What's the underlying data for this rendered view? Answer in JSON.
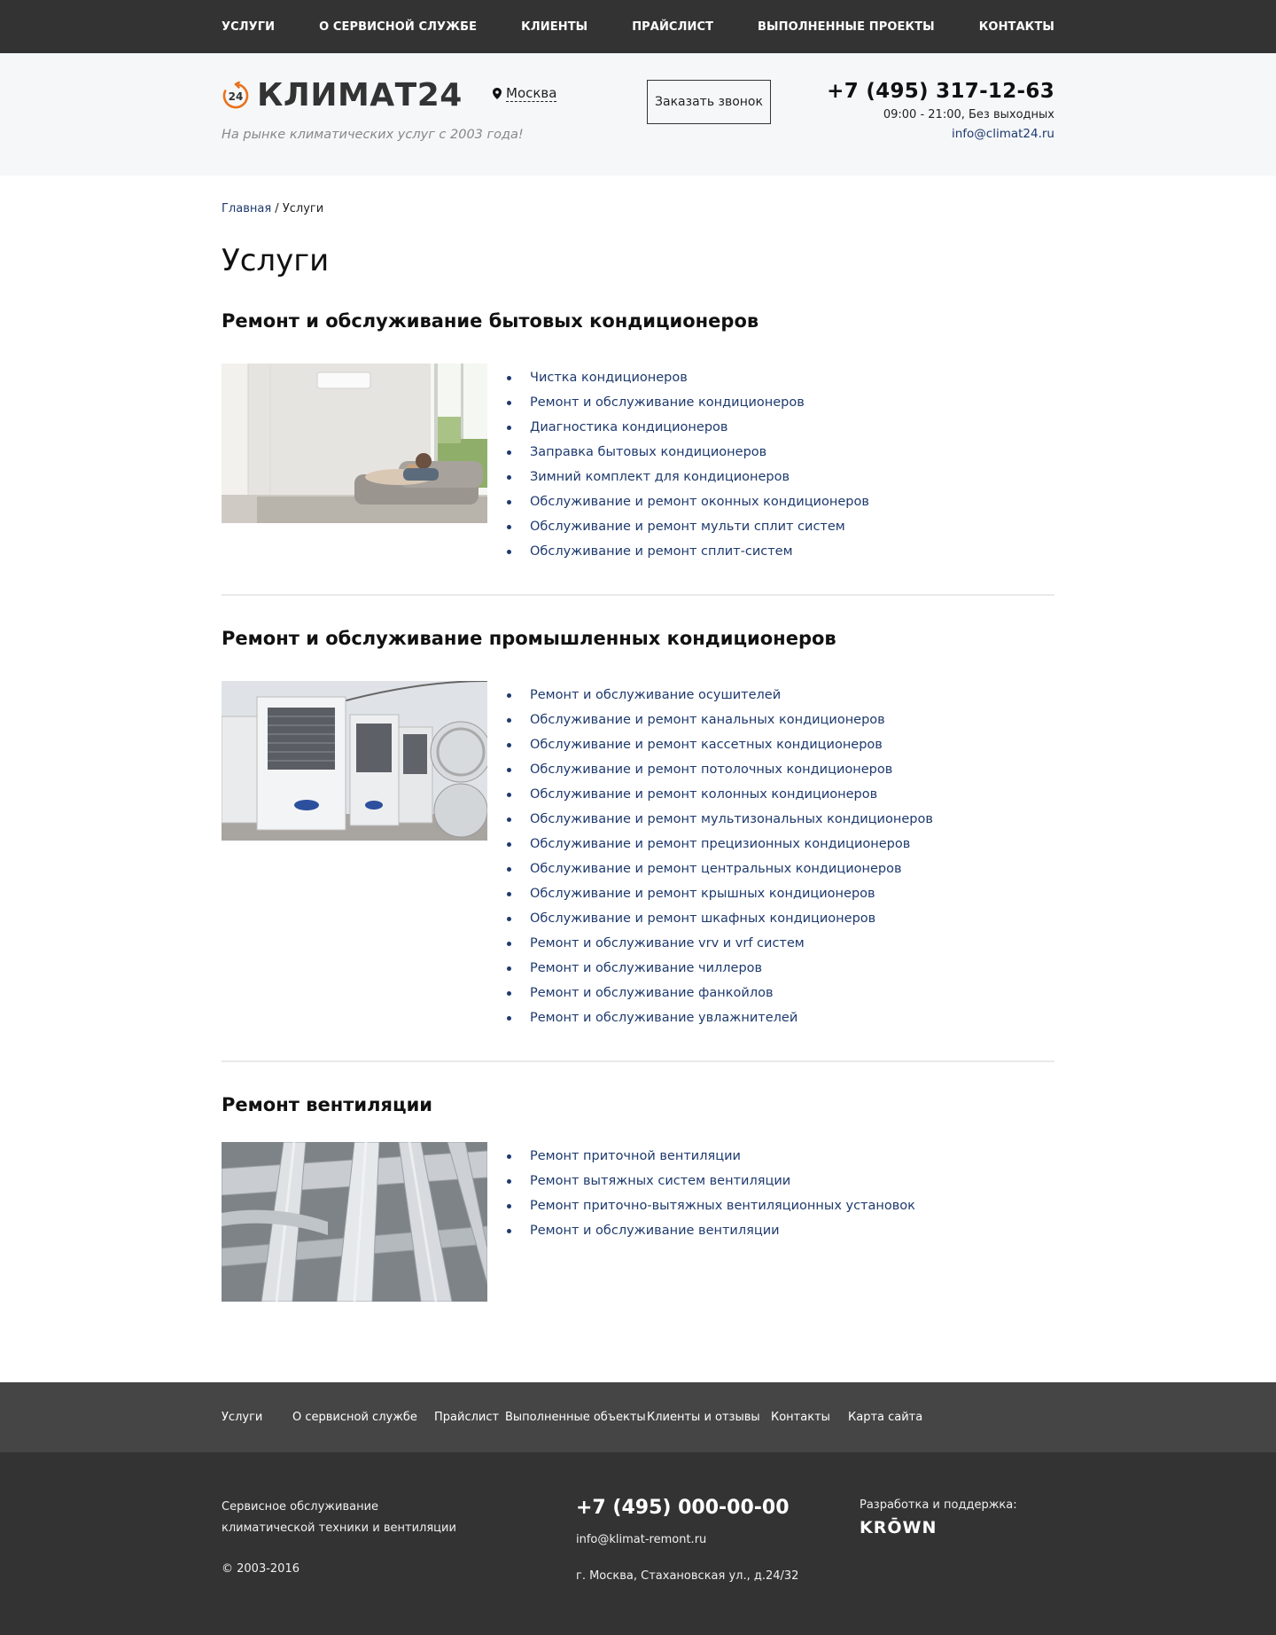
{
  "nav": {
    "items": [
      "УСЛУГИ",
      "О СЕРВИСНОЙ СЛУЖБЕ",
      "КЛИЕНТЫ",
      "ПРАЙСЛИСТ",
      "ВЫПОЛНЕННЫЕ ПРОЕКТЫ",
      "КОНТАКТЫ"
    ]
  },
  "header": {
    "logo_text": "КЛИМАТ24",
    "logo_badge": "24",
    "tagline": "На рынке климатических услуг с 2003 года!",
    "city": "Москва",
    "callback_label": "Заказать звонок",
    "phone": "+7 (495) 317-12-63",
    "hours": "09:00 - 21:00, Без выходных",
    "email": "info@climat24.ru",
    "accent_color": "#e8721c"
  },
  "breadcrumb": {
    "home": "Главная",
    "separator": " / ",
    "current": "Услуги"
  },
  "page_title": "Услуги",
  "sections": [
    {
      "title": "Ремонт и обслуживание бытовых кондиционеров",
      "image": "living-room-air-conditioner",
      "items": [
        "Чистка кондиционеров",
        "Ремонт и обслуживание кондиционеров",
        "Диагностика кондиционеров",
        "Заправка бытовых кондиционеров",
        "Зимний комплект для кондиционеров",
        "Обслуживание и ремонт оконных кондиционеров",
        "Обслуживание и ремонт мульти сплит систем",
        "Обслуживание и ремонт сплит-систем"
      ]
    },
    {
      "title": "Ремонт и обслуживание промышленных кондиционеров",
      "image": "industrial-outdoor-units",
      "items": [
        "Ремонт и обслуживание осушителей",
        "Обслуживание и ремонт канальных кондиционеров",
        "Обслуживание и ремонт кассетных кондиционеров",
        "Обслуживание и ремонт потолочных кондиционеров",
        "Обслуживание и ремонт колонных кондиционеров",
        "Обслуживание и ремонт мультизональных кондиционеров",
        "Обслуживание и ремонт прецизионных кондиционеров",
        "Обслуживание и ремонт центральных кондиционеров",
        "Обслуживание и ремонт крышных кондиционеров",
        "Обслуживание и ремонт шкафных кондиционеров",
        "Ремонт и обслуживание vrv и vrf систем",
        "Ремонт и обслуживание чиллеров",
        "Ремонт и обслуживание фанкойлов",
        "Ремонт и обслуживание увлажнителей"
      ]
    },
    {
      "title": "Ремонт вентиляции",
      "image": "ventilation-ducts",
      "items": [
        "Ремонт приточной вентиляции",
        "Ремонт вытяжных систем вентиляции",
        "Ремонт приточно-вытяжных вентиляционных установок",
        "Ремонт и обслуживание вентиляции"
      ]
    }
  ],
  "footer_nav": {
    "items": [
      "Услуги",
      "О сервисной службе",
      "Прайслист",
      "Выполненные объекты",
      "Клиенты и отзывы",
      "Контакты",
      "Карта сайта"
    ]
  },
  "footer": {
    "description": "Сервисное обслуживание климатической техники и вентиляции",
    "copyright": "© 2003-2016",
    "phone": "+7 (495) 000-00-00",
    "email": "info@klimat-remont.ru",
    "address": "г. Москва, Стахановская ул., д.24/32",
    "dev_label": "Разработка и поддержка:",
    "dev_brand": "KRŌWN"
  }
}
